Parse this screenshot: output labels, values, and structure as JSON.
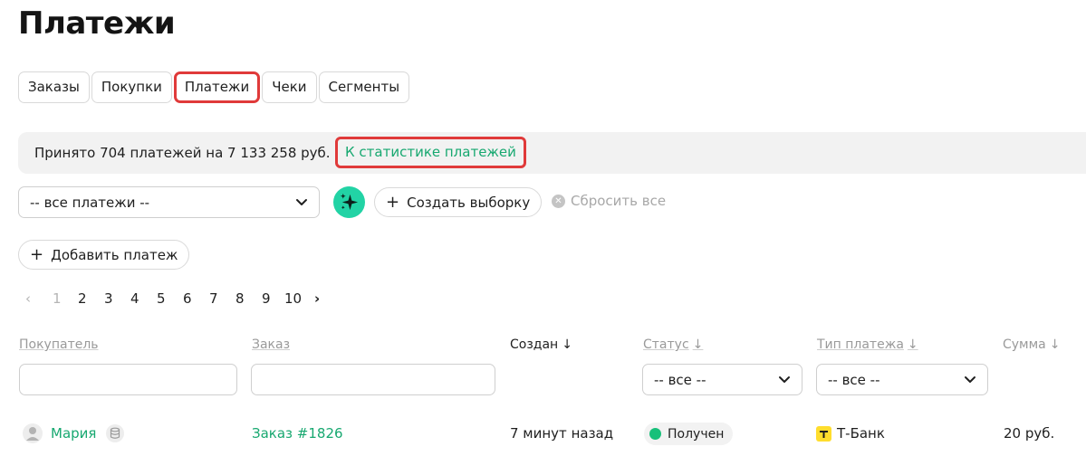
{
  "page": {
    "title": "Платежи"
  },
  "tabs": [
    {
      "label": "Заказы",
      "active": false
    },
    {
      "label": "Покупки",
      "active": false
    },
    {
      "label": "Платежи",
      "active": true
    },
    {
      "label": "Чеки",
      "active": false
    },
    {
      "label": "Сегменты",
      "active": false
    }
  ],
  "summary": {
    "text": "Принято 704 платежей на 7 133 258 руб.",
    "stats_link": "К статистике платежей"
  },
  "filters": {
    "payments_select": "-- все платежи --",
    "create_selection": "Создать выборку",
    "reset_all": "Сбросить все"
  },
  "actions": {
    "add_payment": "Добавить платеж"
  },
  "pagination": {
    "prev": "‹",
    "next": "›",
    "pages": [
      "1",
      "2",
      "3",
      "4",
      "5",
      "6",
      "7",
      "8",
      "9",
      "10"
    ],
    "current": "1"
  },
  "table": {
    "columns": {
      "buyer": "Покупатель",
      "order": "Заказ",
      "created": "Создан",
      "status": "Статус",
      "payment_type": "Тип платежа",
      "amount": "Сумма"
    },
    "sort_arrow": "↓",
    "filters": {
      "status": "-- все --",
      "payment_type": "-- все --"
    },
    "rows": [
      {
        "buyer": "Мария",
        "order": "Заказ #1826",
        "created": "7 минут назад",
        "status": "Получен",
        "payment_type": "Т-Банк",
        "amount": "20 руб."
      }
    ]
  },
  "colors": {
    "accent_green": "#17a870",
    "ai_button": "#22d3a5",
    "highlight_red": "#e03a3a",
    "status_green": "#17c07a",
    "tbank_yellow": "#ffdd2d"
  },
  "icons": {
    "sparkle": "sparkle-icon",
    "plus": "plus-icon",
    "reset": "close-circle-icon",
    "chevron": "chevron-down-icon",
    "user": "user-icon",
    "database": "database-icon",
    "tbank": "tbank-logo-icon"
  }
}
